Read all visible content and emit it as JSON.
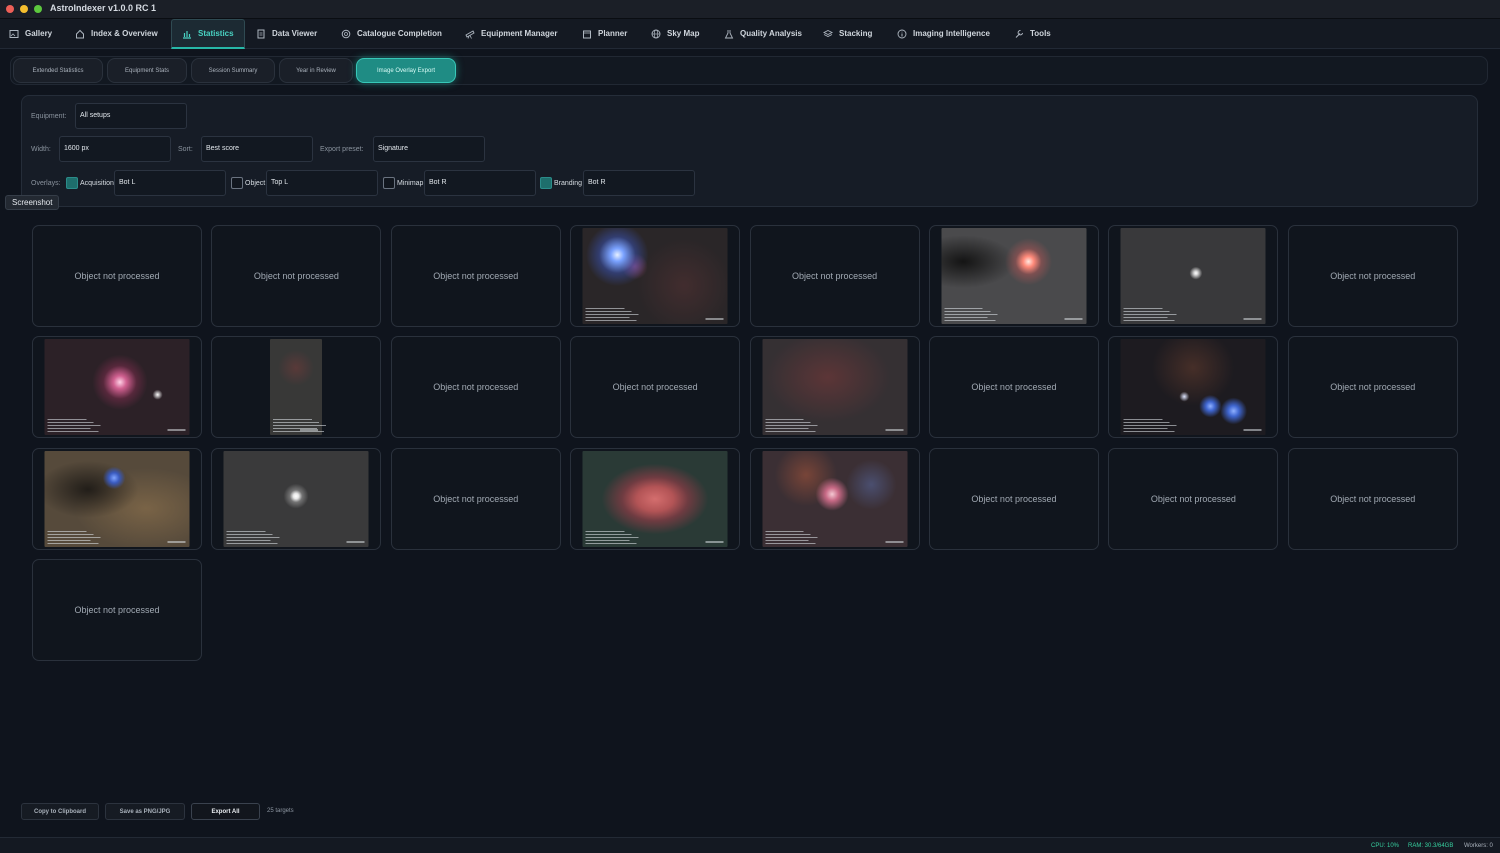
{
  "app": {
    "title": "AstroIndexer v1.0.0 RC 1"
  },
  "nav": {
    "tabs": [
      {
        "label": "Gallery",
        "icon": "image-icon"
      },
      {
        "label": "Index & Overview",
        "icon": "home-icon"
      },
      {
        "label": "Statistics",
        "icon": "bar-chart-icon",
        "active": true
      },
      {
        "label": "Data Viewer",
        "icon": "document-icon"
      },
      {
        "label": "Catalogue Completion",
        "icon": "target-icon"
      },
      {
        "label": "Equipment Manager",
        "icon": "telescope-icon"
      },
      {
        "label": "Planner",
        "icon": "calendar-icon"
      },
      {
        "label": "Sky Map",
        "icon": "globe-icon"
      },
      {
        "label": "Quality Analysis",
        "icon": "flask-icon"
      },
      {
        "label": "Stacking",
        "icon": "layers-icon"
      },
      {
        "label": "Imaging Intelligence",
        "icon": "info-icon"
      },
      {
        "label": "Tools",
        "icon": "wrench-icon"
      }
    ]
  },
  "subnav": {
    "tabs": [
      {
        "label": "Extended Statistics"
      },
      {
        "label": "Equipment Stats"
      },
      {
        "label": "Session Summary"
      },
      {
        "label": "Year in Review"
      },
      {
        "label": "Image Overlay Export",
        "active": true
      }
    ]
  },
  "settings": {
    "equipment_label": "Equipment:",
    "equipment_value": "All setups",
    "width_label": "Width:",
    "width_value": "1600 px",
    "sort_label": "Sort:",
    "sort_value": "Best score",
    "preset_label": "Export preset:",
    "preset_value": "Signature",
    "overlays_label": "Overlays:",
    "overlays": [
      {
        "label": "Acquisition",
        "checked": true,
        "position": "Bot L"
      },
      {
        "label": "Object",
        "checked": false,
        "position": "Top L"
      },
      {
        "label": "Minimap",
        "checked": false,
        "position": "Bot R"
      },
      {
        "label": "Branding",
        "checked": true,
        "position": "Bot R"
      }
    ]
  },
  "tooltip": "Screenshot",
  "grid": {
    "placeholder_text": "Object not processed",
    "tiles": [
      {
        "thumb": null
      },
      {
        "thumb": null
      },
      {
        "thumb": null
      },
      {
        "thumb": "nebula-blue-star"
      },
      {
        "thumb": null
      },
      {
        "thumb": "red-star-dark-nebula"
      },
      {
        "thumb": "galaxy-grey"
      },
      {
        "thumb": null
      },
      {
        "thumb": "pink-nebula-starfield"
      },
      {
        "thumb": "faint-narrow"
      },
      {
        "thumb": null
      },
      {
        "thumb": null
      },
      {
        "thumb": "faint-red-nebula"
      },
      {
        "thumb": null
      },
      {
        "thumb": "blue-stars-dust"
      },
      {
        "thumb": null
      },
      {
        "thumb": "dark-nebula-dust"
      },
      {
        "thumb": "galaxy-bright-core"
      },
      {
        "thumb": null
      },
      {
        "thumb": "rosette-nebula"
      },
      {
        "thumb": "emission-nebula-field"
      },
      {
        "thumb": null
      },
      {
        "thumb": null
      },
      {
        "thumb": null
      },
      {
        "thumb": null
      }
    ]
  },
  "footer": {
    "copy_label": "Copy to Clipboard",
    "save_label": "Save as PNG/JPG",
    "export_label": "Export All",
    "targets_label": "25 targets"
  },
  "status": {
    "cpu": "CPU: 10%",
    "ram": "RAM: 30.3/64GB",
    "workers": "Workers: 0"
  },
  "colors": {
    "accent": "#27b8a8",
    "status_green": "#37d1a0",
    "background": "#0f141d"
  }
}
